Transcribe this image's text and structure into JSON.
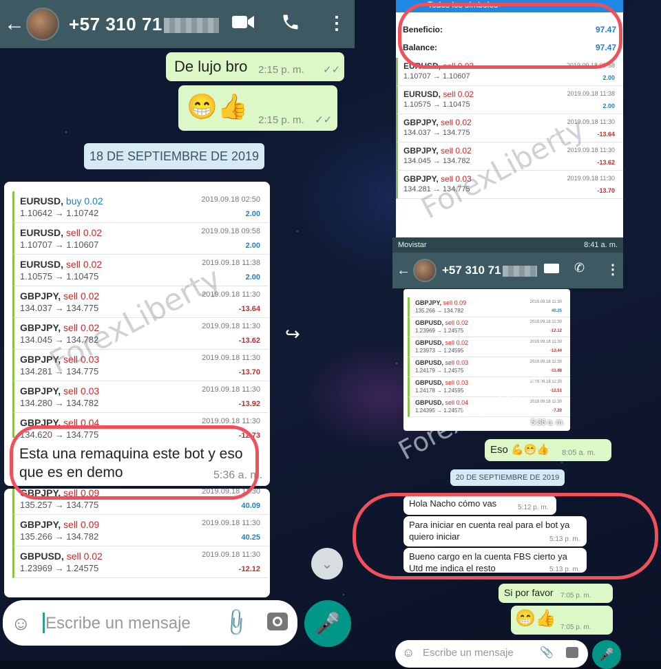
{
  "left": {
    "header": {
      "contact": "+57 310 71"
    },
    "msgs": {
      "m1_text": "De lujo bro",
      "m1_time": "2:15 p. m.",
      "m2_emoji": "😁👍",
      "m2_time": "2:15 p. m."
    },
    "date_chip": "18 DE SEPTIEMBRE DE 2019",
    "trades": [
      {
        "sym": "EURUSD,",
        "side": "buy",
        "lot": "0.02",
        "date": "2019.09.18 02:50",
        "price": "1.10642 → 1.10742",
        "pl": "2.00"
      },
      {
        "sym": "EURUSD,",
        "side": "sell",
        "lot": "0.02",
        "date": "2019.09.18 09:58",
        "price": "1.10707 → 1.10607",
        "pl": "2.00"
      },
      {
        "sym": "EURUSD,",
        "side": "sell",
        "lot": "0.02",
        "date": "2019.09.18 11:38",
        "price": "1.10575 → 1.10475",
        "pl": "2.00"
      },
      {
        "sym": "GBPJPY,",
        "side": "sell",
        "lot": "0.02",
        "date": "2019.09.18 11:30",
        "price": "134.037 → 134.775",
        "pl": "-13.64"
      },
      {
        "sym": "GBPJPY,",
        "side": "sell",
        "lot": "0.02",
        "date": "2019.09.18 11:30",
        "price": "134.045 → 134.782",
        "pl": "-13.62"
      },
      {
        "sym": "GBPJPY,",
        "side": "sell",
        "lot": "0.03",
        "date": "2019.09.18 11:30",
        "price": "134.281 → 134.775",
        "pl": "-13.70"
      },
      {
        "sym": "GBPJPY,",
        "side": "sell",
        "lot": "0.03",
        "date": "2019.09.18 11:30",
        "price": "134.280 → 134.782",
        "pl": "-13.92"
      },
      {
        "sym": "GBPJPY,",
        "side": "sell",
        "lot": "0.04",
        "date": "2019.09.18 11:30",
        "price": "134.620 → 134.775",
        "pl": "-12.73"
      }
    ],
    "caption": "Esta una remaquina este bot y eso que es en demo",
    "caption_time": "5:36 a. m.",
    "trades2": [
      {
        "sym": "GBPJPY,",
        "side": "sell",
        "lot": "0.09",
        "date": "2019.09.18 11:30",
        "price": "135.257 → 134.775",
        "pl": "40.09"
      },
      {
        "sym": "GBPJPY,",
        "side": "sell",
        "lot": "0.09",
        "date": "2019.09.18 11:30",
        "price": "135.266 → 134.782",
        "pl": "40.25"
      },
      {
        "sym": "GBPUSD,",
        "side": "sell",
        "lot": "0.02",
        "date": "2019.09.18 11:30",
        "price": "1.23969 → 1.24575",
        "pl": "-12.12"
      }
    ],
    "input_placeholder": "Escribe un mensaje"
  },
  "watermark": "ForexLiberty",
  "right": {
    "top_title": "Todos los símbolos",
    "summary": {
      "beneficio_label": "Beneficio:",
      "beneficio": "97.47",
      "balance_label": "Balance:",
      "balance": "97.47"
    },
    "trades": [
      {
        "sym": "EURUSD,",
        "side": "sell",
        "lot": "0.02",
        "date": "2019.09.18 09:58",
        "price": "1.10707 → 1.10607",
        "pl": "2.00"
      },
      {
        "sym": "EURUSD,",
        "side": "sell",
        "lot": "0.02",
        "date": "2019.09.18 11:38",
        "price": "1.10575 → 1.10475",
        "pl": "2.00"
      },
      {
        "sym": "GBPJPY,",
        "side": "sell",
        "lot": "0.02",
        "date": "2019.09.18 11:30",
        "price": "134.037 → 134.775",
        "pl": "-13.64"
      },
      {
        "sym": "GBPJPY,",
        "side": "sell",
        "lot": "0.02",
        "date": "2019.09.18 11:30",
        "price": "134.045 → 134.782",
        "pl": "-13.62"
      },
      {
        "sym": "GBPJPY,",
        "side": "sell",
        "lot": "0.03",
        "date": "2019.09.18 11:30",
        "price": "134.281 → 134.775",
        "pl": "-13.70"
      }
    ],
    "status": {
      "carrier": "Movistar",
      "time": "8:41 a. m."
    },
    "contact": "+57 310 71",
    "mini_trades": [
      {
        "sym": "GBPJPY,",
        "side": "sell",
        "lot": "0.09",
        "date": "2019.09.18 11:30",
        "price": "135.266 → 134.782",
        "pl": "40.25"
      },
      {
        "sym": "GBPUSD,",
        "side": "sell",
        "lot": "0.02",
        "date": "2019.09.18 11:30",
        "price": "1.23969 → 1.24575",
        "pl": "-12.12"
      },
      {
        "sym": "GBPUSD,",
        "side": "sell",
        "lot": "0.02",
        "date": "2019.09.18 11:30",
        "price": "1.23973 → 1.24595",
        "pl": "-12.44"
      },
      {
        "sym": "GBPUSD,",
        "side": "sell",
        "lot": "0.03",
        "date": "2019.09.18 11:30",
        "price": "1.24179 → 1.24575",
        "pl": "-11.88"
      },
      {
        "sym": "GBPUSD,",
        "side": "sell",
        "lot": "0.03",
        "date": "2019.09.18 11:30",
        "price": "1.24178 → 1.24595",
        "pl": "-12.51"
      },
      {
        "sym": "GBPUSD,",
        "side": "sell",
        "lot": "0.04",
        "date": "2019.09.18 11:30",
        "price": "1.24395 → 1.24575",
        "pl": "-7.20"
      }
    ],
    "mini_time": "5:36 a. m.",
    "eso_text": "Eso 💪😁👍",
    "eso_time": "8:05 a. m.",
    "date_chip": "20 DE SEPTIEMBRE DE 2019",
    "in1": "Hola Nacho cómo vas",
    "in1_time": "5:12 p. m.",
    "in2": "Para iniciar en cuenta real para el bot ya quiero iniciar",
    "in2_time": "5:13 p. m.",
    "in3": "Bueno cargo en la cuenta FBS cierto ya Utd me indica el resto",
    "in3_time": "5:13 p. m.",
    "out1": "Si por favor",
    "out1_time": "7:05 p. m.",
    "out2": "😁👍",
    "out2_time": "7:05 p. m.",
    "input_placeholder": "Escribe un mensaje"
  }
}
